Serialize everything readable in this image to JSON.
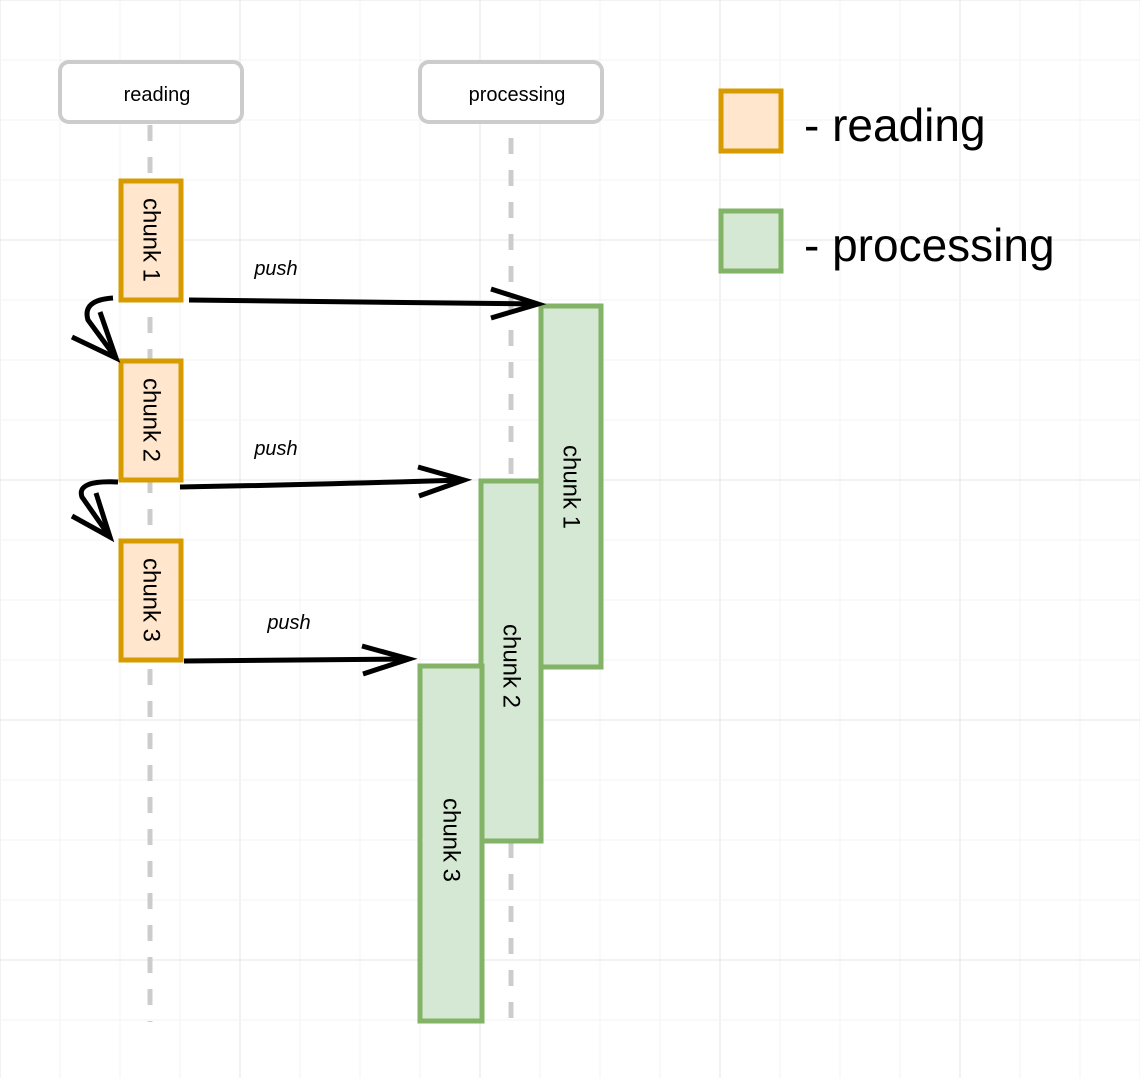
{
  "lanes": {
    "reading": "reading",
    "processing": "processing"
  },
  "reading_chunks": [
    "chunk 1",
    "chunk 2",
    "chunk 3"
  ],
  "processing_chunks": [
    "chunk 1",
    "chunk 2",
    "chunk 3"
  ],
  "messages": [
    "push",
    "push",
    "push"
  ],
  "legend": {
    "reading": "- reading",
    "processing": "- processing"
  },
  "colors": {
    "reading_fill": "#ffe6cc",
    "reading_stroke": "#d79b00",
    "processing_fill": "#d5e8d4",
    "processing_stroke": "#82b366",
    "lane_stroke": "#cccccc"
  }
}
